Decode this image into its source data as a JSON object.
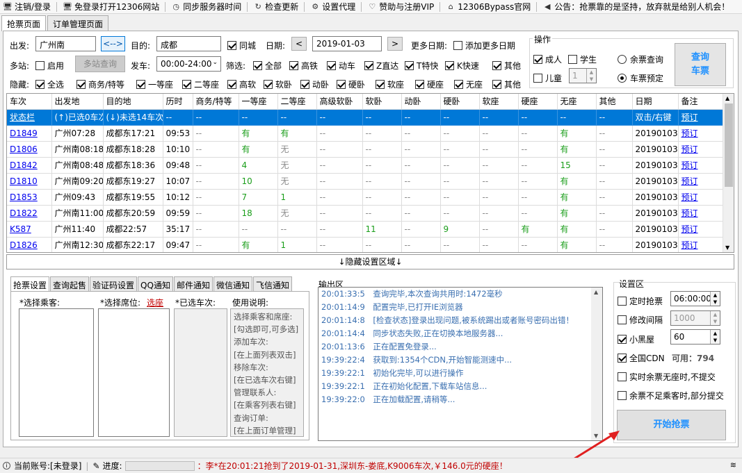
{
  "toolbar": [
    {
      "icon": "monitor-icon",
      "glyph": "🖥",
      "label": "注销/登录"
    },
    {
      "icon": "monitor-icon",
      "glyph": "🖥",
      "label": "免登录打开12306网站"
    },
    {
      "icon": "clock-icon",
      "glyph": "◷",
      "label": "同步服务器时间"
    },
    {
      "icon": "refresh-icon",
      "glyph": "↻",
      "label": "检查更新"
    },
    {
      "icon": "gear-icon",
      "glyph": "⚙",
      "label": "设置代理"
    },
    {
      "icon": "heart-icon",
      "glyph": "♡",
      "label": "赞助与注册VIP"
    },
    {
      "icon": "home-icon",
      "glyph": "⌂",
      "label": "12306Bypass官网"
    },
    {
      "icon": "speaker-icon",
      "glyph": "◀",
      "label": "公告：抢票靠的是坚持，放弃就是给别人机会！"
    }
  ],
  "tabs": [
    "抢票页面",
    "订单管理页面"
  ],
  "search": {
    "from_label": "出发:",
    "from_value": "广州南",
    "swap": "<-->",
    "to_label": "目的:",
    "to_value": "成都",
    "samecity": "同城",
    "date_label": "日期:",
    "prev": "<",
    "date_value": "2019-01-03",
    "next": ">",
    "more_dates_label": "更多日期:",
    "add_more_dates": "添加更多日期",
    "multi_label": "多站:",
    "multi_enable": "启用",
    "multi_query": "多站查询",
    "depart_label": "发车:",
    "depart_value": "00:00-24:00",
    "filter_label": "筛选:",
    "filters": [
      "全部",
      "高铁",
      "动车",
      "Z直达",
      "T特快",
      "K快速",
      "其他"
    ],
    "hide_label": "隐藏:",
    "hides": [
      "全选",
      "商务/特等",
      "一等座",
      "二等座",
      "高软",
      "软卧",
      "动卧",
      "硬卧",
      "软座",
      "硬座",
      "无座",
      "其他"
    ]
  },
  "ops": {
    "title": "操作",
    "adult": "成人",
    "student": "学生",
    "child": "儿童",
    "child_count": "1",
    "remain_query": "余票查询",
    "reserve": "车票预定",
    "query_btn_line1": "查询",
    "query_btn_line2": "车票"
  },
  "grid": {
    "headers": [
      "车次",
      "出发地",
      "目的地",
      "历时",
      "商务/特等",
      "一等座",
      "二等座",
      "高级软卧",
      "软卧",
      "动卧",
      "硬卧",
      "软座",
      "硬座",
      "无座",
      "其他",
      "日期",
      "备注"
    ],
    "status_row": [
      "状态栏",
      "(↑)已选0车次",
      "(↓)未选14车次",
      "--",
      "--",
      "--",
      "--",
      "--",
      "--",
      "--",
      "--",
      "--",
      "--",
      "--",
      "--",
      "双击/右键",
      "预订"
    ],
    "rows": [
      [
        "D1849",
        "广州07:28",
        "成都东17:21",
        "09:53",
        "--",
        "有",
        "有",
        "--",
        "--",
        "--",
        "--",
        "--",
        "--",
        "有",
        "--",
        "20190103",
        "预订"
      ],
      [
        "D1806",
        "广州南08:18",
        "成都东18:28",
        "10:10",
        "--",
        "有",
        "无",
        "--",
        "--",
        "--",
        "--",
        "--",
        "--",
        "有",
        "--",
        "20190103",
        "预订"
      ],
      [
        "D1842",
        "广州南08:48",
        "成都东18:36",
        "09:48",
        "--",
        "4",
        "无",
        "--",
        "--",
        "--",
        "--",
        "--",
        "--",
        "15",
        "--",
        "20190103",
        "预订"
      ],
      [
        "D1810",
        "广州南09:20",
        "成都东19:27",
        "10:07",
        "--",
        "10",
        "无",
        "--",
        "--",
        "--",
        "--",
        "--",
        "--",
        "有",
        "--",
        "20190103",
        "预订"
      ],
      [
        "D1853",
        "广州09:43",
        "成都东19:55",
        "10:12",
        "--",
        "7",
        "1",
        "--",
        "--",
        "--",
        "--",
        "--",
        "--",
        "有",
        "--",
        "20190103",
        "预订"
      ],
      [
        "D1822",
        "广州南11:00",
        "成都东20:59",
        "09:59",
        "--",
        "18",
        "无",
        "--",
        "--",
        "--",
        "--",
        "--",
        "--",
        "有",
        "--",
        "20190103",
        "预订"
      ],
      [
        "K587",
        "广州11:40",
        "成都22:57",
        "35:17",
        "--",
        "--",
        "--",
        "--",
        "11",
        "--",
        "9",
        "--",
        "有",
        "有",
        "--",
        "20190103",
        "预订"
      ],
      [
        "D1826",
        "广州南12:30",
        "成都东22:17",
        "09:47",
        "--",
        "有",
        "1",
        "--",
        "--",
        "--",
        "--",
        "--",
        "--",
        "有",
        "--",
        "20190103",
        "预订"
      ]
    ]
  },
  "hide_area": "↓隐藏设置区域↓",
  "bottom_tabs": [
    "抢票设置",
    "查询起售",
    "验证码设置",
    "QQ通知",
    "邮件通知",
    "微信通知",
    "飞信通知"
  ],
  "bottom": {
    "passenger": "*选择乘客:",
    "seat": "*选择席位:",
    "seat_link": "选座",
    "selected": "*已选车次:",
    "usage": "使用说明:",
    "usage_lines": [
      "选择乘客和席座:",
      "[勾选即可,可多选]",
      "添加车次:",
      "[在上面列表双击]",
      "移除车次:",
      "[在已选车次右键]",
      "管理联系人:",
      "[在乘客列表右键]",
      "查询订单:",
      "[在上面订单管理]"
    ]
  },
  "output": {
    "title": "输出区",
    "lines": [
      "20:01:33:5　查询完毕,本次查询共用时:1472毫秒",
      "20:01:14:9　配置完毕,已打开IE浏览器",
      "20:01:14:8　[检查状态]登录出现问题,被系统踢出或者账号密码出错！",
      "20:01:14:4　同步状态失败,正在切换本地服务器...",
      "20:01:13:6　正在配置免登录...",
      "19:39:22:4　获取到:1354个CDN,开始智能测速中...",
      "19:39:22:1　初始化完毕,可以进行操作",
      "19:39:22:1　正在初始化配置,下载车站信息...",
      "19:39:22:0　正在加载配置,请稍等..."
    ]
  },
  "settings": {
    "title": "设置区",
    "timed": "定时抢票",
    "timed_value": "06:00:00",
    "interval": "修改间隔",
    "interval_value": "1000",
    "blackroom": "小黑屋",
    "blackroom_value": "60",
    "cdn": "全国CDN",
    "cdn_avail": "可用：794",
    "noseat": "实时余票无座时,不提交",
    "partial": "余票不足乘客时,部分提交",
    "start": "开始抢票"
  },
  "statusbar": {
    "account": "当前账号:[未登录]",
    "progress": "进度:",
    "message": "：李*在20:01:21抢到了2019-01-31,深圳东-娄底,K9006车次,￥146.0元的硬座！"
  }
}
